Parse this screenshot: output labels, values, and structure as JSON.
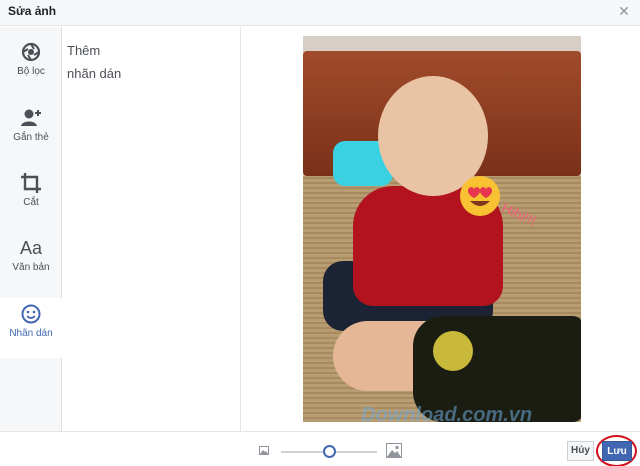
{
  "dialog": {
    "title": "Sửa ảnh",
    "close_icon": "close-icon"
  },
  "sidebar": {
    "items": [
      {
        "label": "Bộ lọc",
        "icon": "filter-icon",
        "active": false
      },
      {
        "label": "Gắn thẻ",
        "icon": "tag-person-icon",
        "active": false
      },
      {
        "label": "Cắt",
        "icon": "crop-icon",
        "active": false
      },
      {
        "label": "Văn bản",
        "icon": "text-aa-icon",
        "icon_text": "Aa",
        "active": false
      },
      {
        "label": "Nhãn dán",
        "icon": "sticker-smiley-icon",
        "active": true
      }
    ]
  },
  "panel": {
    "text": "Thêm nhãn dán"
  },
  "photo": {
    "sticker_text": "Hihi!!!",
    "sticker_icon": "heart-eyes-emoji-icon"
  },
  "watermark": {
    "text": "Download.com.vn",
    "dot_colors": [
      "#a9d8f2",
      "#d9d9d9",
      "#c6e3a9",
      "#f8c99a",
      "#a9d8f2",
      "#f5a9b5"
    ]
  },
  "footer": {
    "zoom_small_icon": "image-small-icon",
    "zoom_large_icon": "image-large-icon",
    "zoom_level": 0.5,
    "cancel_label": "Hủy",
    "save_label": "Lưu"
  },
  "colors": {
    "accent": "#4267b2",
    "highlight_ring": "#d0101a"
  }
}
